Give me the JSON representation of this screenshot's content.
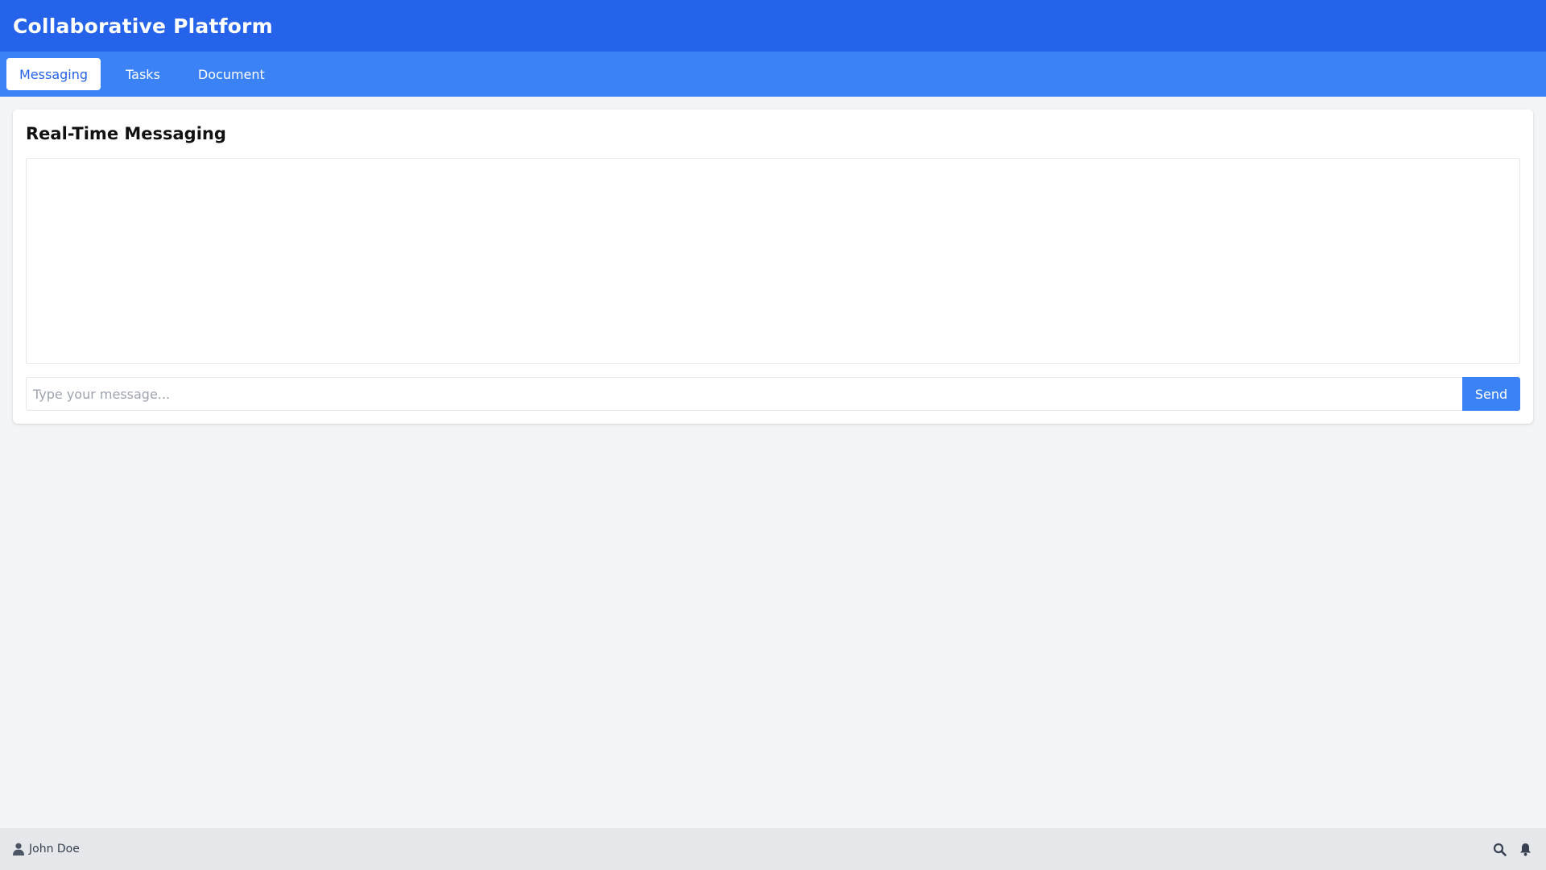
{
  "app": {
    "title": "Collaborative Platform"
  },
  "tabs": [
    {
      "label": "Messaging",
      "active": true
    },
    {
      "label": "Tasks",
      "active": false
    },
    {
      "label": "Document",
      "active": false
    }
  ],
  "messaging": {
    "heading": "Real-Time Messaging",
    "input_value": "",
    "input_placeholder": "Type your message...",
    "send_label": "Send"
  },
  "status_bar": {
    "user_name": "John Doe",
    "user_icon": "user-icon",
    "actions": [
      "search-icon",
      "bell-icon"
    ]
  },
  "colors": {
    "header": "#2563eb",
    "tab_bar": "#3b82f6",
    "accent": "#3b82f6",
    "background": "#f3f4f6",
    "status_bar": "#e5e7eb"
  }
}
